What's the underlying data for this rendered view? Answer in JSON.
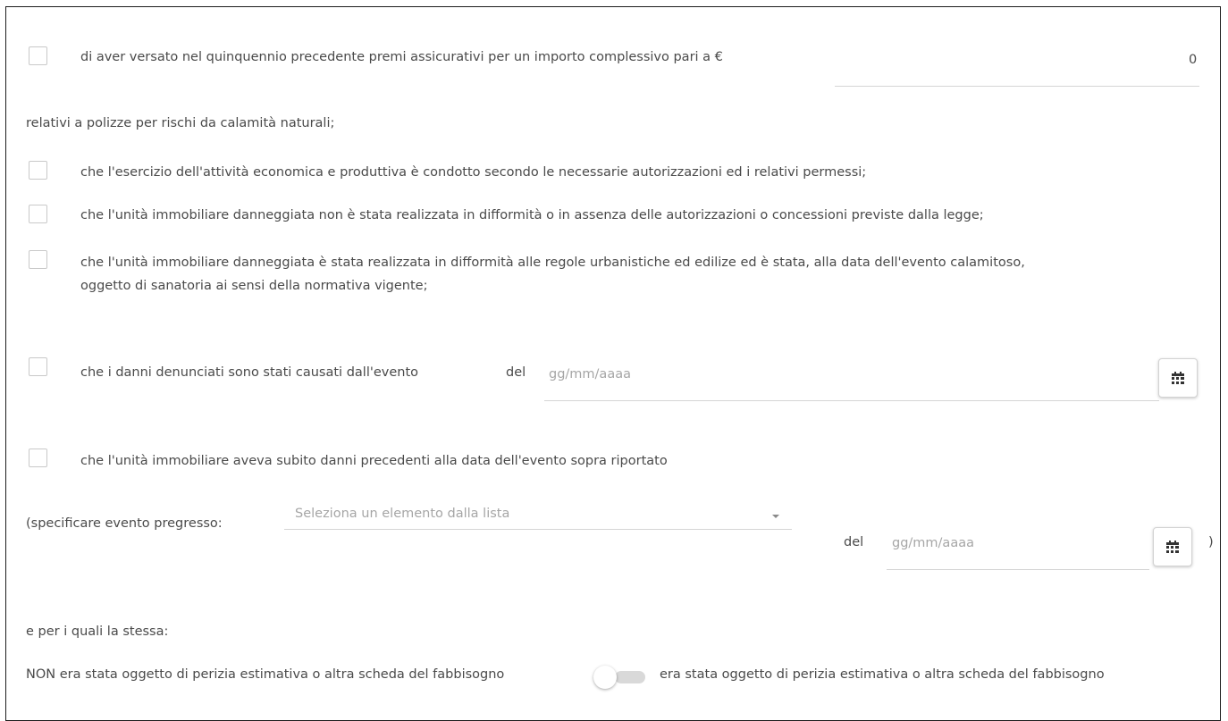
{
  "rows": {
    "premi": {
      "label": "di aver versato nel quinquennio precedente premi assicurativi per un importo complessivo pari a €",
      "amount_value": "0",
      "continuation": "relativi a polizze per rischi da calamità naturali;"
    },
    "autorizzazioni": {
      "label": "che l'esercizio dell'attività economica e produttiva è condotto secondo le necessarie autorizzazioni ed i relativi permessi;"
    },
    "conformita": {
      "label": "che l'unità immobiliare danneggiata non è stata realizzata in difformità o in assenza delle autorizzazioni o concessioni previste dalla legge;"
    },
    "sanatoria": {
      "line1": "che l'unità immobiliare danneggiata è stata realizzata in difformità alle regole urbanistiche ed edilize ed è stata, alla data dell'evento calamitoso,",
      "line2": "oggetto di sanatoria ai sensi della normativa vigente;"
    },
    "danni_evento": {
      "label": "che i danni denunciati sono stati causati dall'evento",
      "del_label": "del",
      "date_placeholder": "gg/mm/aaaa"
    },
    "danni_precedenti": {
      "label": "che l'unità immobiliare aveva subito danni precedenti alla data dell'evento sopra riportato"
    }
  },
  "evento_pregresso": {
    "label": "(specificare evento pregresso:",
    "select_placeholder": "Seleziona un elemento dalla lista",
    "del_label": "del",
    "date_placeholder": "gg/mm/aaaa",
    "close_paren": ")"
  },
  "stessa": {
    "label": "e per i quali la stessa:"
  },
  "perizia": {
    "left_label": "NON era stata oggetto di perizia estimativa o altra scheda del fabbisogno",
    "right_label": "era stata oggetto di perizia estimativa o altra scheda del fabbisogno",
    "toggle_on": false
  },
  "icons": {
    "calendar": "calendar-icon",
    "dropdown": "caret-down-icon"
  }
}
